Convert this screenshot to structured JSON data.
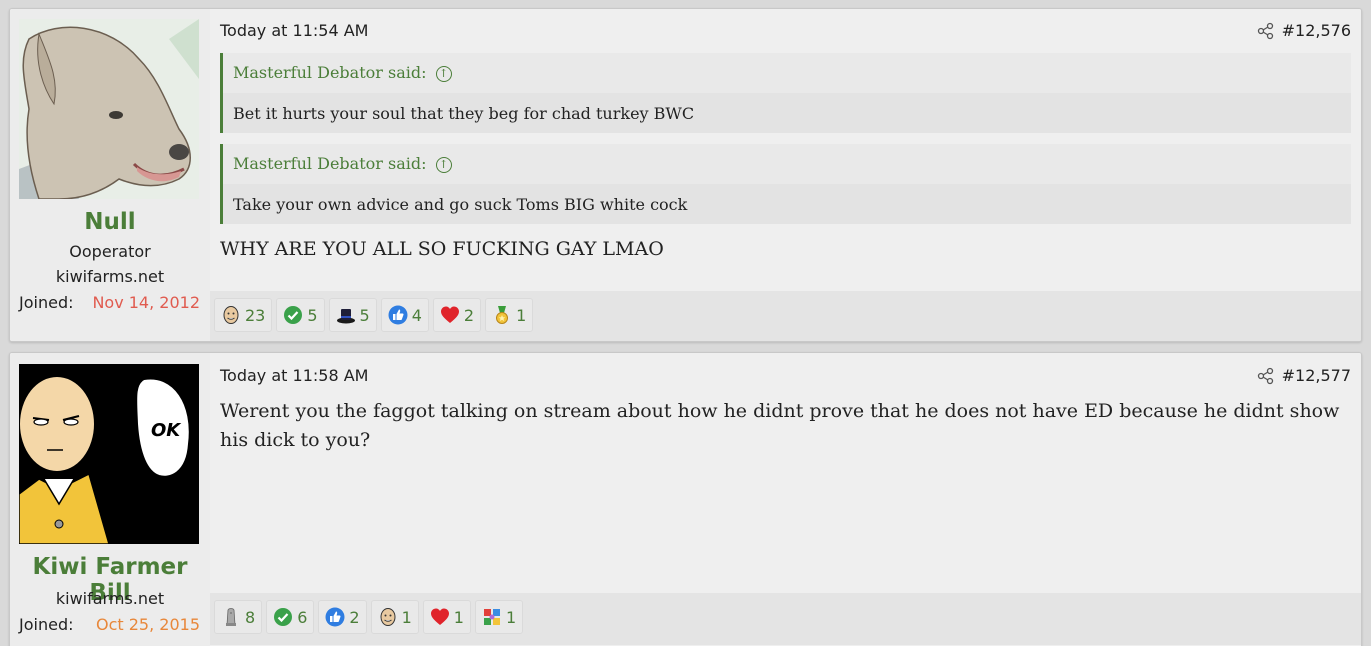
{
  "posts": [
    {
      "user": {
        "name": "Null",
        "title": "Ooperator",
        "site": "kiwifarms.net",
        "joined_label": "Joined:",
        "joined_date": "Nov 14, 2012",
        "joined_color": "#e05b4f"
      },
      "date": "Today at 11:54 AM",
      "number": "#12,576",
      "quotes": [
        {
          "author": "Masterful Debator said:",
          "text": "Bet it hurts your soul that they beg for chad turkey BWC"
        },
        {
          "author": "Masterful Debator said:",
          "text": "Take your own advice and go suck Toms BIG white cock"
        }
      ],
      "body": "WHY ARE YOU ALL SO FUCKING GAY LMAO",
      "reactions": [
        {
          "icon": "face-icon",
          "count": "23"
        },
        {
          "icon": "check-icon",
          "count": "5"
        },
        {
          "icon": "tophat-icon",
          "count": "5"
        },
        {
          "icon": "thumbs-up-icon",
          "count": "4"
        },
        {
          "icon": "heart-icon",
          "count": "2"
        },
        {
          "icon": "medal-icon",
          "count": "1"
        }
      ]
    },
    {
      "user": {
        "name": "Kiwi Farmer Bill",
        "site": "kiwifarms.net",
        "joined_label": "Joined:",
        "joined_date": "Oct 25, 2015",
        "joined_color": "#e8873a"
      },
      "date": "Today at 11:58 AM",
      "number": "#12,577",
      "body": "Werent you the faggot talking on stream about how he didnt prove that he does not have ED because he didnt show his dick to you?",
      "avatar_text": "OK",
      "reactions": [
        {
          "icon": "winner-icon",
          "count": "8"
        },
        {
          "icon": "check-icon",
          "count": "6"
        },
        {
          "icon": "thumbs-up-icon",
          "count": "2"
        },
        {
          "icon": "face-icon",
          "count": "1"
        },
        {
          "icon": "heart-icon",
          "count": "1"
        },
        {
          "icon": "puzzle-icon",
          "count": "1"
        }
      ]
    }
  ]
}
